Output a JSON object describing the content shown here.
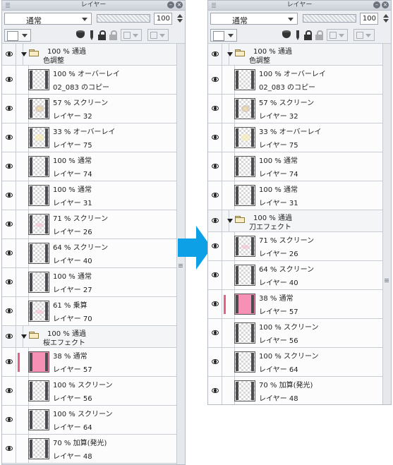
{
  "panel_title": "レイヤー",
  "blend_mode": "通常",
  "opacity_value": "100",
  "left_panel": {
    "layers": [
      {
        "type": "folder",
        "line1": "100 % 通過",
        "line2": "色調整"
      },
      {
        "type": "layer",
        "line1": "100 % オーバーレイ",
        "line2": "02_083 のコピー"
      },
      {
        "type": "layer",
        "line1": "57 % スクリーン",
        "line2": "レイヤー 32",
        "thumb": "violet-yellow"
      },
      {
        "type": "layer",
        "line1": "33 % オーバーレイ",
        "line2": "レイヤー 75",
        "thumb": "yellow"
      },
      {
        "type": "layer",
        "line1": "100 % 通常",
        "line2": "レイヤー 74"
      },
      {
        "type": "layer",
        "line1": "100 % 通常",
        "line2": "レイヤー 31"
      },
      {
        "type": "layer",
        "line1": "71 % スクリーン",
        "line2": "レイヤー 26",
        "thumb": "pink-light"
      },
      {
        "type": "layer",
        "line1": "64 % スクリーン",
        "line2": "レイヤー 40"
      },
      {
        "type": "layer",
        "line1": "100 % 通常",
        "line2": "レイヤー 27"
      },
      {
        "type": "layer",
        "line1": "61 % 乗算",
        "line2": "レイヤー 70",
        "thumb": "pink-light"
      },
      {
        "type": "folder",
        "line1": "100 % 通過",
        "line2": "桜エフェクト"
      },
      {
        "type": "layer",
        "line1": "38 % 通常",
        "line2": "レイヤー 57",
        "thumb": "pink",
        "active": true
      },
      {
        "type": "layer",
        "line1": "100 % スクリーン",
        "line2": "レイヤー 56"
      },
      {
        "type": "layer",
        "line1": "100 % スクリーン",
        "line2": "レイヤー 64"
      },
      {
        "type": "layer",
        "line1": "70 % 加算(発光)",
        "line2": "レイヤー 48"
      }
    ]
  },
  "right_panel": {
    "layers": [
      {
        "type": "folder",
        "line1": "100 % 通過",
        "line2": "色調整"
      },
      {
        "type": "layer",
        "line1": "100 % オーバーレイ",
        "line2": "02_083 のコピー"
      },
      {
        "type": "layer",
        "line1": "57 % スクリーン",
        "line2": "レイヤー 32",
        "thumb": "violet-yellow"
      },
      {
        "type": "layer",
        "line1": "33 % オーバーレイ",
        "line2": "レイヤー 75",
        "thumb": "yellow"
      },
      {
        "type": "layer",
        "line1": "100 % 通常",
        "line2": "レイヤー 74"
      },
      {
        "type": "layer",
        "line1": "100 % 通常",
        "line2": "レイヤー 31"
      },
      {
        "type": "folder",
        "line1": "100 % 通過",
        "line2": "刀エフェクト"
      },
      {
        "type": "layer",
        "line1": "71 % スクリーン",
        "line2": "レイヤー 26",
        "thumb": "pink-light"
      },
      {
        "type": "layer",
        "line1": "64 % スクリーン",
        "line2": "レイヤー 40"
      },
      {
        "type": "layer",
        "line1": "38 % 通常",
        "line2": "レイヤー 57",
        "thumb": "pink",
        "active": true
      },
      {
        "type": "layer",
        "line1": "100 % スクリーン",
        "line2": "レイヤー 56"
      },
      {
        "type": "layer",
        "line1": "100 % スクリーン",
        "line2": "レイヤー 64"
      },
      {
        "type": "layer",
        "line1": "70 % 加算(発光)",
        "line2": "レイヤー 48"
      }
    ]
  },
  "colors": {
    "arrow": "#0ea0e6",
    "active_marker": "#e85f84",
    "pink_thumb": "#f690b5"
  }
}
